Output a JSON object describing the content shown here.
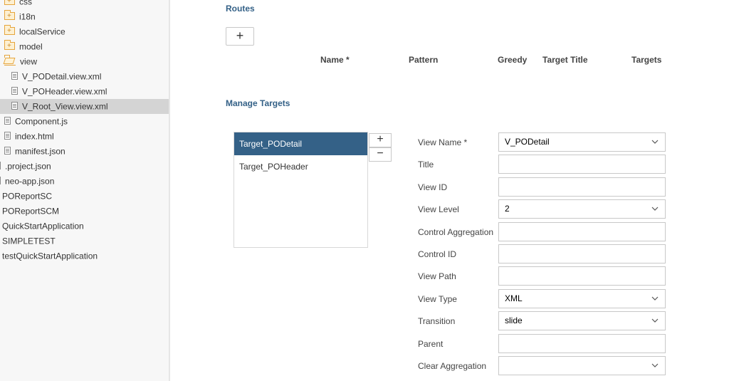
{
  "sidebar": {
    "items": [
      {
        "label": "css",
        "icon": "folder-plus"
      },
      {
        "label": "i18n",
        "icon": "folder-plus"
      },
      {
        "label": "localService",
        "icon": "folder-plus"
      },
      {
        "label": "model",
        "icon": "folder-plus"
      },
      {
        "label": "view",
        "icon": "folder-open"
      },
      {
        "label": "V_PODetail.view.xml",
        "icon": "file"
      },
      {
        "label": "V_POHeader.view.xml",
        "icon": "file"
      },
      {
        "label": "V_Root_View.view.xml",
        "icon": "file",
        "selected": true
      },
      {
        "label": "Component.js",
        "icon": "file"
      },
      {
        "label": "index.html",
        "icon": "file"
      },
      {
        "label": "manifest.json",
        "icon": "file"
      },
      {
        "label": ".project.json",
        "icon": "small-file"
      },
      {
        "label": "neo-app.json",
        "icon": "small-file"
      },
      {
        "label": "POReportSC",
        "icon": "none"
      },
      {
        "label": "POReportSCM",
        "icon": "none"
      },
      {
        "label": "QuickStartApplication",
        "icon": "none"
      },
      {
        "label": "SIMPLETEST",
        "icon": "none"
      },
      {
        "label": "testQuickStartApplication",
        "icon": "none"
      }
    ]
  },
  "routes": {
    "title": "Routes",
    "add_label": "+",
    "columns": [
      "Name *",
      "Pattern",
      "Greedy",
      "Target Title",
      "Targets"
    ]
  },
  "manage_targets": {
    "title": "Manage Targets",
    "add_label": "+",
    "remove_label": "−",
    "list": [
      "Target_PODetail",
      "Target_POHeader"
    ],
    "selected_index": 0
  },
  "form": {
    "fields": [
      {
        "label": "View Name *",
        "value": "V_PODetail",
        "type": "select"
      },
      {
        "label": "Title",
        "value": "",
        "type": "text"
      },
      {
        "label": "View ID",
        "value": "",
        "type": "text"
      },
      {
        "label": "View Level",
        "value": "2",
        "type": "select"
      },
      {
        "label": "Control Aggregation",
        "value": "",
        "type": "text"
      },
      {
        "label": "Control ID",
        "value": "",
        "type": "text"
      },
      {
        "label": "View Path",
        "value": "",
        "type": "text"
      },
      {
        "label": "View Type",
        "value": "XML",
        "type": "select"
      },
      {
        "label": "Transition",
        "value": "slide",
        "type": "select"
      },
      {
        "label": "Parent",
        "value": "",
        "type": "text"
      },
      {
        "label": "Clear Aggregation",
        "value": "",
        "type": "select"
      }
    ]
  },
  "colors": {
    "accent": "#346187",
    "sidebar_bg": "#f7f7f7",
    "selection": "#d4d4d4",
    "folder": "#e6a53c"
  }
}
